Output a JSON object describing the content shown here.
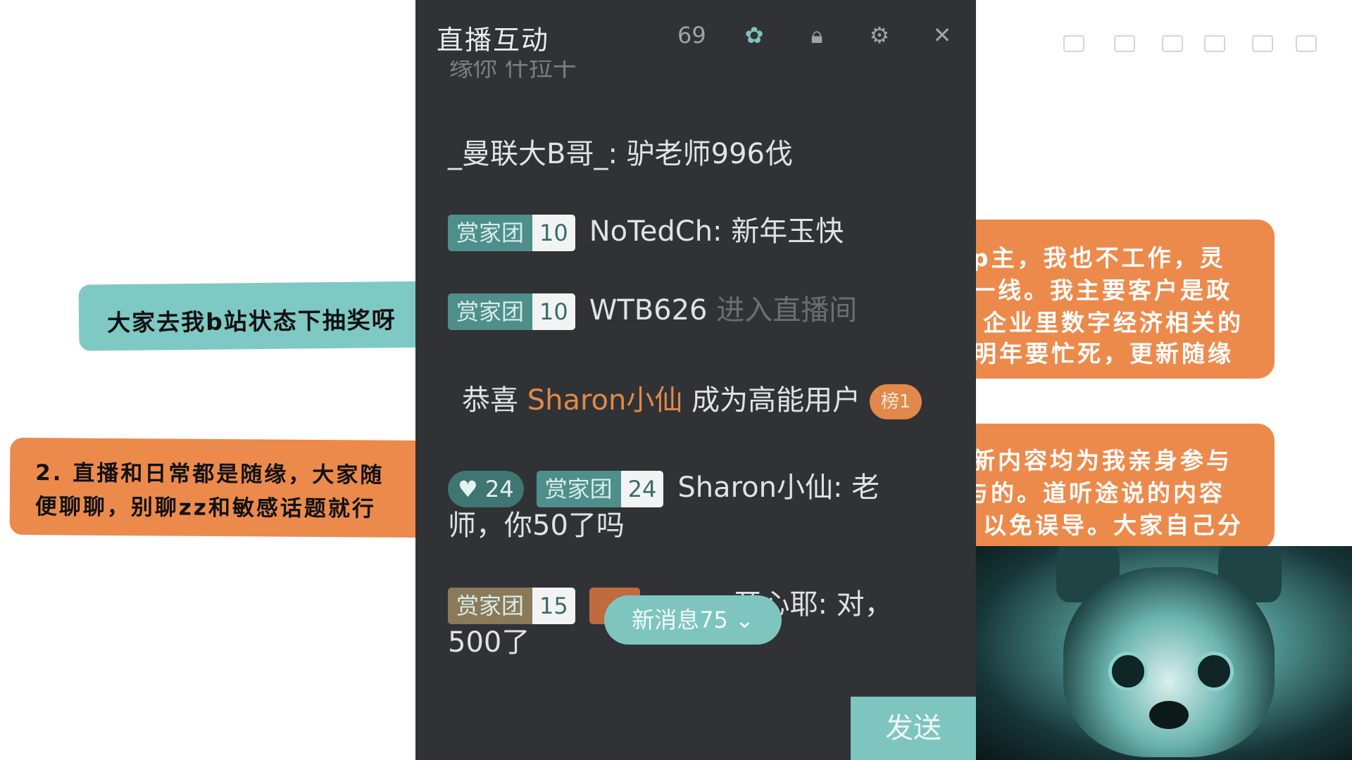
{
  "slide": {
    "teal_note": "大家去我b站状态下抽奖呀",
    "orange_left": [
      "2. 直播和日常都是随缘，大家随",
      "便聊聊，别聊zz和敏感话题就行"
    ],
    "orange_right_top": [
      "p主，我也不工作，灵",
      "一线。我主要客户是政",
      "企业里数字经济相关的",
      "明年要忙死，更新随缘"
    ],
    "orange_right_bottom": [
      "新内容均为我亲身参与",
      "与的。道听途说的内容",
      "以免误导。大家自己分"
    ]
  },
  "panel": {
    "title": "直播互动",
    "controls": [
      {
        "icon": "69",
        "name": "count-icon"
      },
      {
        "icon": "✿",
        "name": "gift-effect-icon"
      },
      {
        "icon": "🔒︎",
        "name": "lock-icon"
      },
      {
        "icon": "⚙",
        "name": "settings-icon"
      },
      {
        "icon": "✕",
        "name": "close-icon"
      }
    ],
    "faded_top": "缘你  什拉干",
    "messages": [
      {
        "user": "_曼联大B哥_",
        "text": "驴老师996伐"
      },
      {
        "medal": "赏家团",
        "level": "10",
        "user": "NoTedCh",
        "text": "新年玉快"
      },
      {
        "medal": "赏家团",
        "level": "10",
        "user": "WTB626",
        "text": "进入直播间"
      },
      {
        "guard": "24",
        "medal": "赏家团",
        "level": "24",
        "user": "Sharon小仙",
        "text_line1": "老",
        "text_line2": "师，你50了吗"
      },
      {
        "medal": "赏家团",
        "level": "15",
        "user_fragment": "开心耶",
        "text_line1": "对，",
        "text_line2": "500了"
      }
    ],
    "system": {
      "prefix": "恭喜",
      "name": "Sharon小仙",
      "suffix": "成为高能用户",
      "badge": "榜1"
    },
    "new_messages": "新消息75",
    "send": "发送"
  }
}
